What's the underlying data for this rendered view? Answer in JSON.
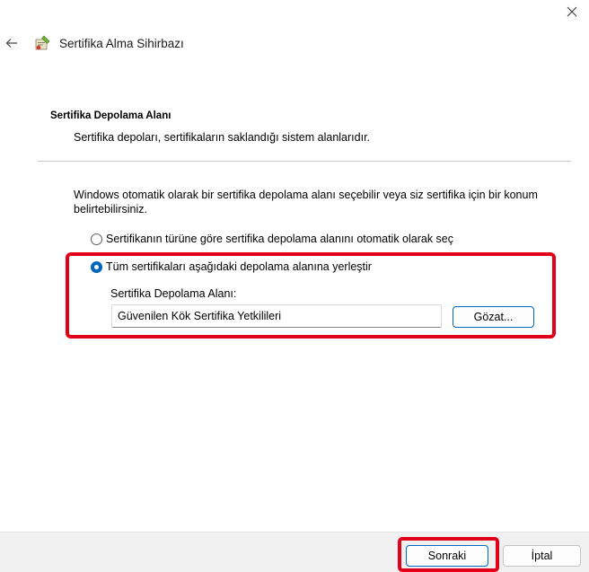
{
  "window": {
    "title": "Sertifika Alma Sihirbazı",
    "close_icon": "close-icon",
    "back_icon": "back-arrow-icon",
    "wizard_icon": "certificate-wizard-icon"
  },
  "section": {
    "title": "Sertifika Depolama Alanı",
    "description": "Sertifika depoları, sertifikaların saklandığı sistem alanlarıdır."
  },
  "intro": "Windows otomatik olarak bir sertifika depolama alanı seçebilir veya siz sertifika için bir konum belirtebilirsiniz.",
  "options": [
    {
      "label": "Sertifikanın türüne göre sertifika depolama alanını otomatik olarak seç",
      "selected": false
    },
    {
      "label": "Tüm sertifikaları aşağıdaki depolama alanına yerleştir",
      "selected": true
    }
  ],
  "store": {
    "label": "Sertifika Depolama Alanı:",
    "value": "Güvenilen Kök Sertifika Yetkilileri",
    "browse_label": "Gözat..."
  },
  "footer": {
    "next_label": "Sonraki",
    "cancel_label": "İptal"
  },
  "colors": {
    "accent": "#0067c0",
    "highlight": "#e0001a",
    "footer_bg": "#f0f0f0"
  }
}
